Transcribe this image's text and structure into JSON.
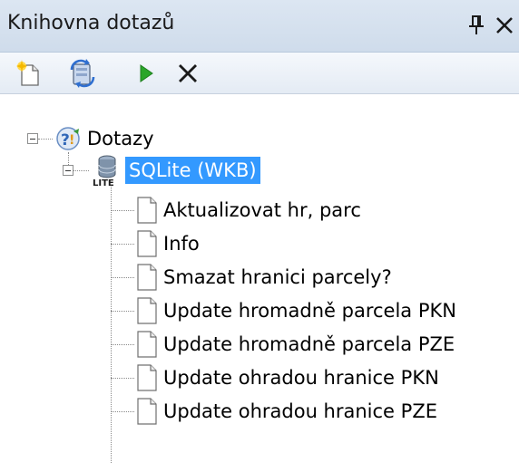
{
  "panel": {
    "title": "Knihovna dotazů"
  },
  "titlebar_buttons": [
    {
      "name": "pin-icon"
    },
    {
      "name": "close-icon"
    }
  ],
  "toolbar": {
    "buttons": [
      {
        "name": "new-query-button",
        "icon": "new-document-icon"
      },
      {
        "name": "refresh-button",
        "icon": "refresh-database-icon"
      },
      {
        "name": "run-button",
        "icon": "play-icon"
      },
      {
        "name": "delete-button",
        "icon": "delete-x-icon"
      }
    ]
  },
  "tree": {
    "root": {
      "label": "Dotazy",
      "icon": "query-group-icon",
      "expanded": true
    },
    "database": {
      "label": "SQLite (WKB)",
      "icon": "database-lite-icon",
      "badge": "LITE",
      "expanded": true,
      "selected": true
    },
    "queries": [
      {
        "label": "Aktualizovat hr, parc"
      },
      {
        "label": "Info"
      },
      {
        "label": "Smazat hranici parcely?"
      },
      {
        "label": "Update hromadně parcela PKN"
      },
      {
        "label": "Update hromadně parcela PZE"
      },
      {
        "label": "Update ohradou hranice PKN"
      },
      {
        "label": "Update ohradou hranice PZE"
      }
    ]
  },
  "colors": {
    "selection": "#3399ff",
    "titlebar": "#dce6f2",
    "run_green": "#2aa52a"
  }
}
